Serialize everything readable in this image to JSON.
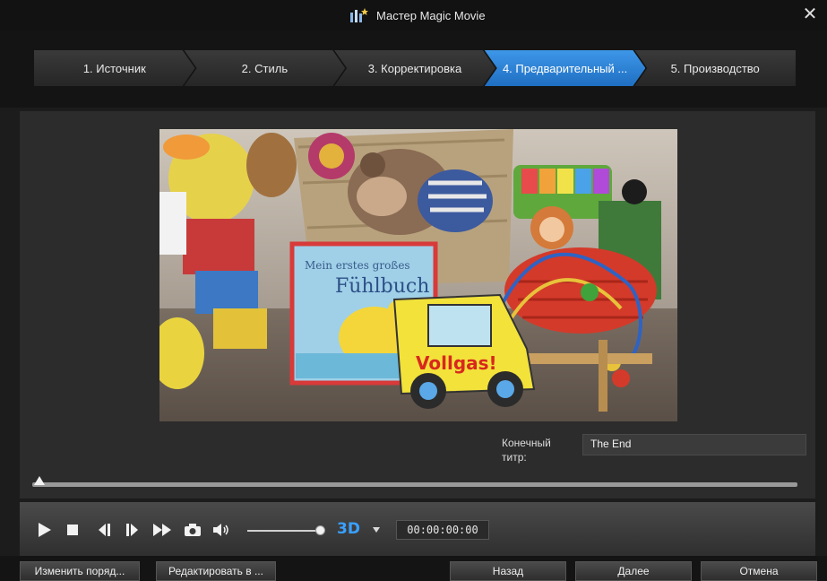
{
  "window": {
    "title": "Мастер Magic Movie",
    "close_symbol": "✕"
  },
  "steps": [
    {
      "label": "1. Источник",
      "active": false
    },
    {
      "label": "2. Стиль",
      "active": false
    },
    {
      "label": "3. Корректировка",
      "active": false
    },
    {
      "label": "4. Предварительный ...",
      "active": true
    },
    {
      "label": "5. Производство",
      "active": false
    }
  ],
  "preview": {
    "book_title_small": "Mein erstes großes",
    "book_title": "Fühlbuch",
    "car_text": "Vollgas!"
  },
  "end_title": {
    "label": "Конечный титр:",
    "value": "The End"
  },
  "player": {
    "timecode": "00:00:00:00",
    "mode_label": "3D",
    "volume": 1.0,
    "position": 0.0
  },
  "buttons": {
    "reorder": "Изменить поряд...",
    "edit_in": "Редактировать в ...",
    "back": "Назад",
    "next": "Далее",
    "cancel": "Отмена"
  },
  "colors": {
    "accent": "#2a86de",
    "threed": "#3aa0ff"
  }
}
